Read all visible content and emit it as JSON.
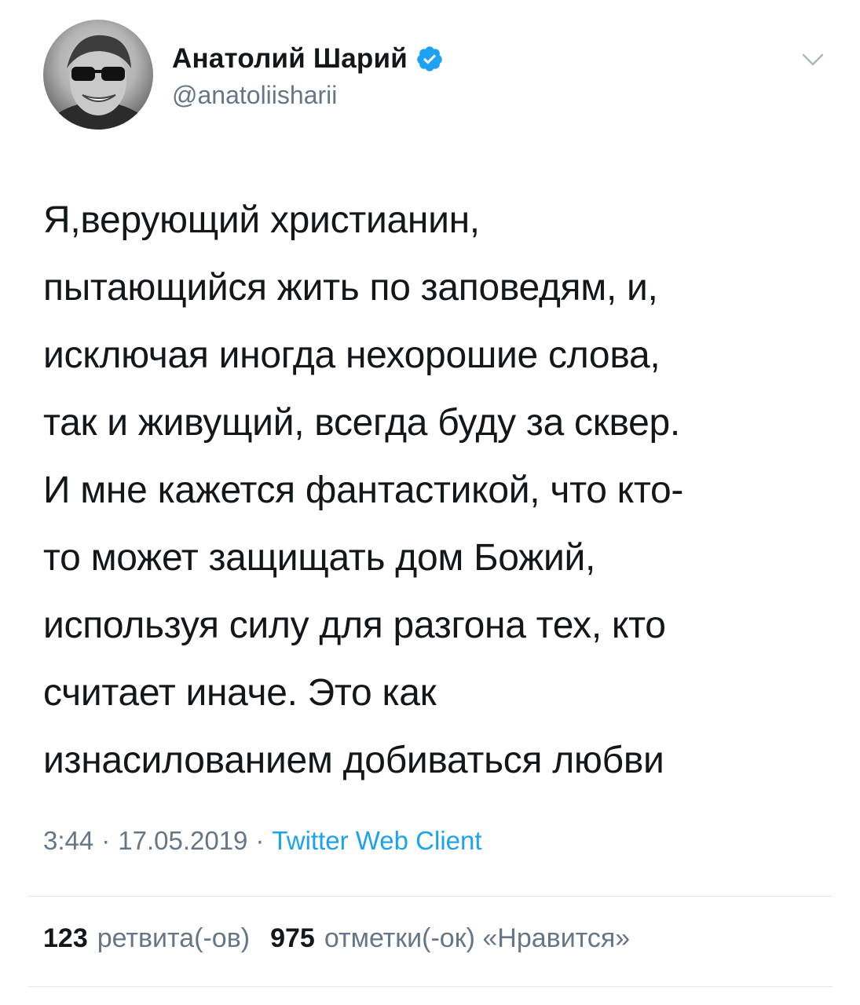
{
  "author": {
    "display_name": "Анатолий Шарий",
    "handle": "@anatoliisharii",
    "verified": true,
    "avatar_icon": "user-avatar-photo",
    "verified_icon": "verified-badge-icon",
    "menu_icon": "chevron-down-icon"
  },
  "tweet": {
    "lines": [
      "Я,верующий христианин,",
      "пытающийся жить по заповедям, и,",
      "исключая иногда нехорошие слова,",
      "так и живущий, всегда буду за сквер.",
      "И мне кажется фантастикой, что кто-",
      "то может защищать дом Божий,",
      "используя силу для разгона тех, кто",
      "считает иначе. Это как",
      "изнасилованием добиваться любви"
    ]
  },
  "meta": {
    "time": "3:44",
    "separator": "·",
    "date": "17.05.2019",
    "source": "Twitter Web Client"
  },
  "stats": {
    "retweets_count": "123",
    "retweets_label": "ретвита(-ов)",
    "likes_count": "975",
    "likes_label": "отметки(-ок) «Нравится»"
  },
  "colors": {
    "text": "#14171a",
    "secondary": "#657786",
    "accent": "#1da1f2",
    "divider": "#e1e8ed"
  }
}
